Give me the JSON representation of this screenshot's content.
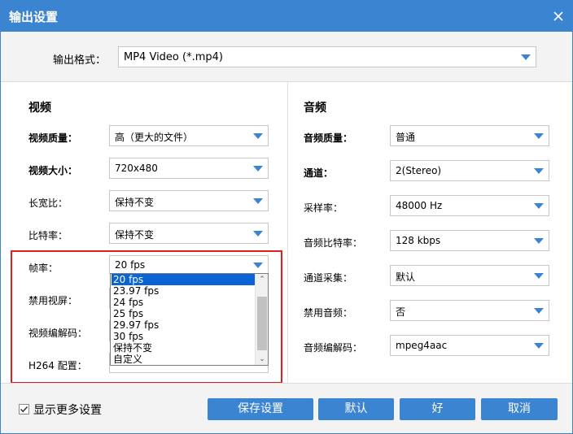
{
  "window": {
    "title": "输出设置"
  },
  "format": {
    "label": "输出格式：",
    "value": "MP4 Video (*.mp4)"
  },
  "video": {
    "title": "视频",
    "quality": {
      "label": "视频质量：",
      "value": "高（更大的文件）"
    },
    "size": {
      "label": "视频大小：",
      "value": "720x480"
    },
    "aspect": {
      "label": "长宽比：",
      "value": "保持不变"
    },
    "bitrate": {
      "label": "比特率：",
      "value": "保持不变"
    },
    "framerate": {
      "label": "帧率：",
      "value": "20 fps"
    },
    "disable": {
      "label": "禁用视屏："
    },
    "codec": {
      "label": "视频编解码："
    },
    "h264": {
      "label": "H264 配置："
    },
    "framerate_options": [
      "20 fps",
      "23.97 fps",
      "24 fps",
      "25 fps",
      "29.97 fps",
      "30 fps",
      "保持不变",
      "自定义"
    ],
    "framerate_selected_index": 0
  },
  "audio": {
    "title": "音频",
    "quality": {
      "label": "音频质量：",
      "value": "普通"
    },
    "channel": {
      "label": "通道：",
      "value": "2(Stereo)"
    },
    "samplerate": {
      "label": "采样率：",
      "value": "48000 Hz"
    },
    "bitrate": {
      "label": "音频比特率：",
      "value": "128 kbps"
    },
    "capture": {
      "label": "通道采集：",
      "value": "默认"
    },
    "disable": {
      "label": "禁用音频：",
      "value": "否"
    },
    "codec": {
      "label": "音频编解码：",
      "value": "mpeg4aac"
    }
  },
  "footer": {
    "more_settings": "显示更多设置",
    "more_settings_checked": true,
    "save": "保存设置",
    "default": "默认",
    "ok": "好",
    "cancel": "取消"
  },
  "colors": {
    "accent": "#3b84d1",
    "highlight": "#e02020",
    "selection": "#0a64d6"
  }
}
